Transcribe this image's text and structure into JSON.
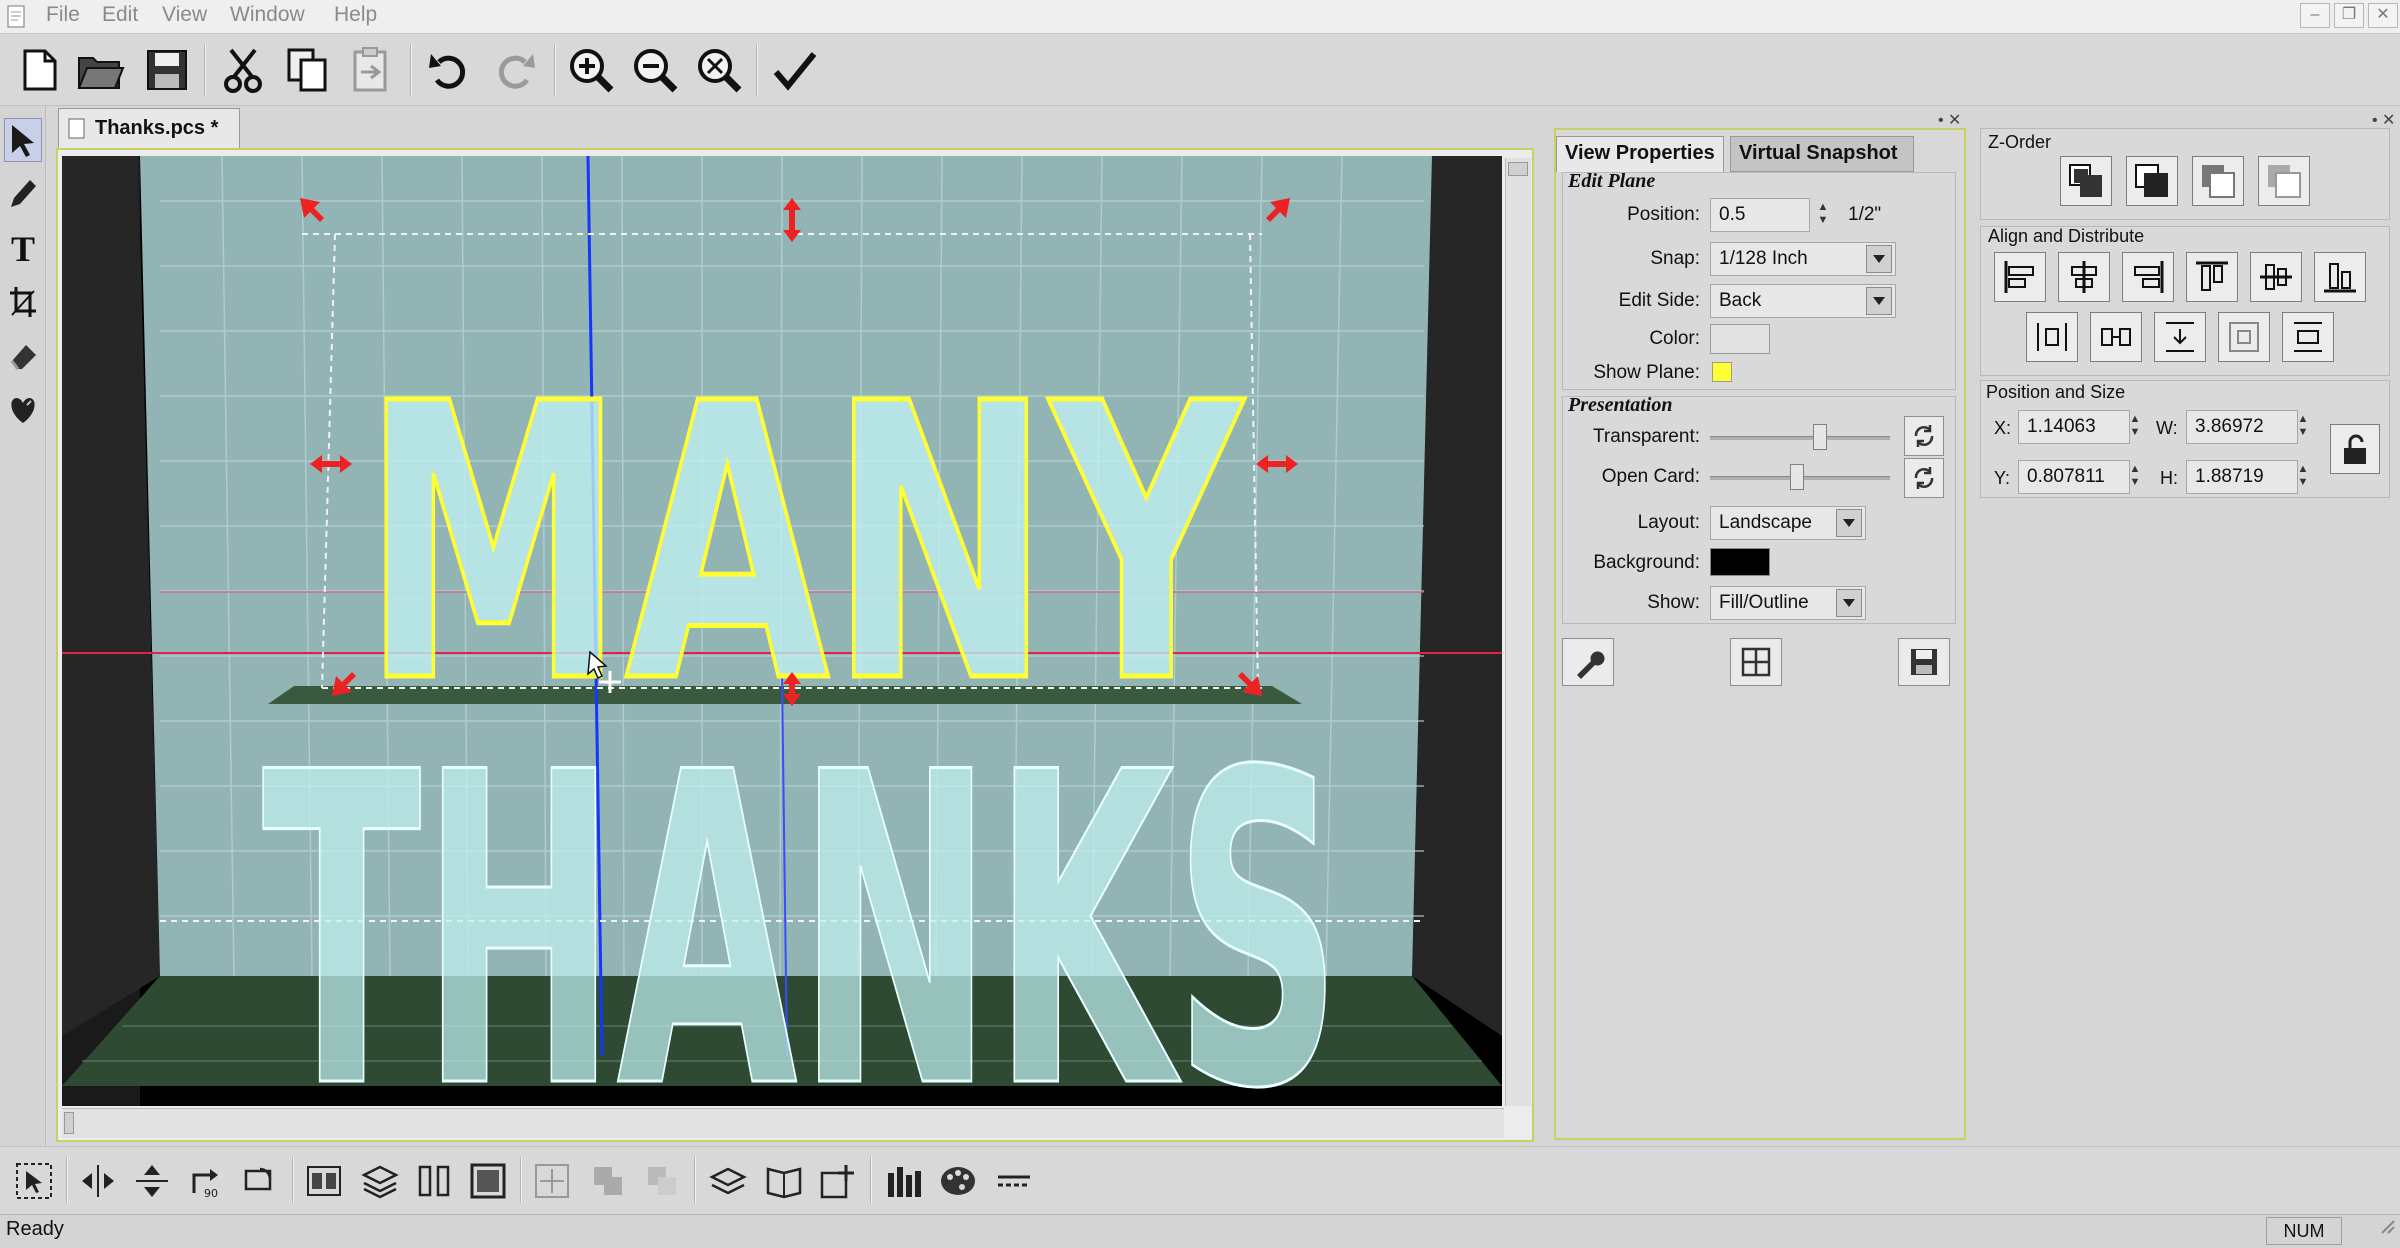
{
  "app": {
    "window_title": "",
    "document_tab": "Thanks.pcs *"
  },
  "menu": {
    "items": [
      "File",
      "Edit",
      "View",
      "Window",
      "Help"
    ]
  },
  "toolbar": {
    "icons": [
      "new-file-icon",
      "open-folder-icon",
      "save-icon",
      "cut-icon",
      "copy-icon",
      "paste-icon",
      "undo-icon",
      "redo-icon",
      "zoom-in-icon",
      "zoom-out-icon",
      "zoom-fit-icon",
      "checkmark-icon"
    ]
  },
  "left_tools": {
    "icons": [
      "pointer-icon",
      "pen-icon",
      "text-icon",
      "crop-icon",
      "eraser-icon",
      "heart-shape-icon"
    ]
  },
  "canvas": {
    "top_text": "MANY",
    "bottom_text": "THANKS",
    "colors": {
      "letter_fill": "#bff0f0",
      "selection_outline": "#ffff33",
      "handle": "#ee2222",
      "background": "#000000",
      "wall": "#93b4b5",
      "floor": "#2f4a33"
    }
  },
  "view_properties": {
    "tabs": [
      "View Properties",
      "Virtual Snapshot"
    ],
    "edit_plane": {
      "title": "Edit Plane",
      "position_label": "Position:",
      "position_value": "0.5",
      "position_fraction": "1/2\"",
      "snap_label": "Snap:",
      "snap_value": "1/128 Inch",
      "edit_side_label": "Edit Side:",
      "edit_side_value": "Back",
      "color_label": "Color:",
      "show_plane_label": "Show Plane:"
    },
    "presentation": {
      "title": "Presentation",
      "transparent_label": "Transparent:",
      "transparent_level": 0.62,
      "open_card_label": "Open Card:",
      "open_card_level": 0.48,
      "layout_label": "Layout:",
      "layout_value": "Landscape",
      "background_label": "Background:",
      "show_label": "Show:",
      "show_value": "Fill/Outline"
    },
    "bottom_buttons": [
      "wrench-icon",
      "grid-view-icon",
      "save-icon"
    ]
  },
  "right_panel": {
    "z_order_title": "Z-Order",
    "align_title": "Align and Distribute",
    "pos_size_title": "Position and Size",
    "x_label": "X:",
    "x_value": "1.14063",
    "w_label": "W:",
    "w_value": "3.86972",
    "y_label": "Y:",
    "y_value": "0.807811",
    "h_label": "H:",
    "h_value": "1.88719"
  },
  "status": {
    "text": "Ready",
    "num": "NUM"
  }
}
